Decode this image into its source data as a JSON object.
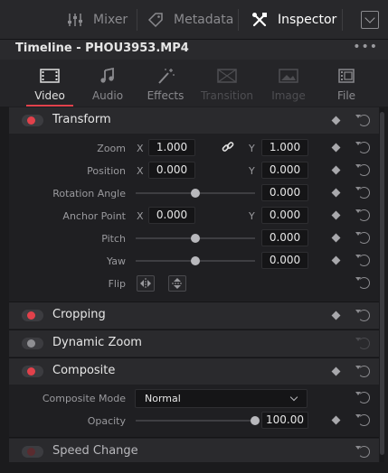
{
  "toolbar": {
    "mixer_label": "Mixer",
    "metadata_label": "Metadata",
    "inspector_label": "Inspector"
  },
  "clip": {
    "title": "Timeline - PHOU3953.MP4",
    "more": "•••"
  },
  "tabs": [
    {
      "label": "Video",
      "icon": "film-icon",
      "state": "active"
    },
    {
      "label": "Audio",
      "icon": "music-note-icon",
      "state": "normal"
    },
    {
      "label": "Effects",
      "icon": "magic-wand-icon",
      "state": "normal"
    },
    {
      "label": "Transition",
      "icon": "transition-icon",
      "state": "disabled"
    },
    {
      "label": "Image",
      "icon": "image-icon",
      "state": "disabled"
    },
    {
      "label": "File",
      "icon": "file-icon",
      "state": "normal"
    }
  ],
  "transform": {
    "title": "Transform",
    "enabled": true,
    "zoom": {
      "label": "Zoom",
      "x_label": "X",
      "x": "1.000",
      "y_label": "Y",
      "y": "1.000"
    },
    "position": {
      "label": "Position",
      "x_label": "X",
      "x": "0.000",
      "y_label": "Y",
      "y": "0.000"
    },
    "rotation": {
      "label": "Rotation Angle",
      "value": "0.000",
      "slider_fraction": 0.5
    },
    "anchor": {
      "label": "Anchor Point",
      "x_label": "X",
      "x": "0.000",
      "y_label": "Y",
      "y": "0.000"
    },
    "pitch": {
      "label": "Pitch",
      "value": "0.000",
      "slider_fraction": 0.5
    },
    "yaw": {
      "label": "Yaw",
      "value": "0.000",
      "slider_fraction": 0.5
    },
    "flip": {
      "label": "Flip"
    }
  },
  "cropping": {
    "title": "Cropping",
    "enabled": true
  },
  "dynamic_zoom": {
    "title": "Dynamic Zoom",
    "enabled": false
  },
  "composite": {
    "title": "Composite",
    "enabled": true,
    "mode": {
      "label": "Composite Mode",
      "value": "Normal"
    },
    "opacity": {
      "label": "Opacity",
      "value": "100.00",
      "slider_fraction": 1.0
    }
  },
  "speed_change": {
    "title": "Speed Change",
    "enabled": false
  },
  "colors": {
    "accent": "#e2414b",
    "panel": "#1f1f22",
    "header": "#2a2a2d"
  }
}
